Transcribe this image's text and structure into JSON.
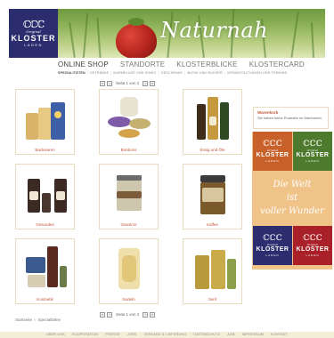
{
  "brand": {
    "mark": "ℂℂℂ",
    "orig": "Original",
    "name": "KLOSTER",
    "sub": "LADEN"
  },
  "hero": {
    "text": "Naturnah"
  },
  "main_nav": [
    "ONLINE SHOP",
    "STANDORTE",
    "KLOSTERBLICKE",
    "KLOSTERCARD"
  ],
  "sub_nav": [
    "SPEZIALITÄTEN",
    "GETRÄNKE",
    "MARMELADE UND HONIG",
    "GESCHENKE",
    "MUSIK UND BÜCHER",
    "VERANSTALTUNGEN UND TERMINE"
  ],
  "pager": {
    "prev": "‹",
    "next": "›",
    "first": "«",
    "last": "»",
    "text": "Seite 1 von 2"
  },
  "products": [
    {
      "label": "Backwaren"
    },
    {
      "label": "Bonbons"
    },
    {
      "label": "Essig und Öle"
    },
    {
      "label": "Gesundes"
    },
    {
      "label": "Gewürze"
    },
    {
      "label": "Kaffee"
    },
    {
      "label": "Kosmetik"
    },
    {
      "label": "Nudeln"
    },
    {
      "label": "Senf"
    }
  ],
  "cart": {
    "title": "Warenkorb",
    "text": "Sie haben keine Produkte im Warenkorb."
  },
  "promo": {
    "line1": "Die Welt",
    "line2": "ist",
    "line3": "voller Wunder"
  },
  "breadcrumb": [
    "Startseite",
    "Spezialitäten"
  ],
  "breadcrumb_sep": "»",
  "footer": [
    "ÜBER UNS",
    "KOOPERATION",
    "PRESSE",
    "JOBS",
    "VERSAND & LIEFERUNG",
    "DATENSCHUTZ",
    "AGB",
    "IMPRESSUM",
    "KONTAKT"
  ],
  "colors": {
    "navy": "#2b2d6e",
    "orange": "#c8602a",
    "green": "#4e7a2e",
    "red": "#a92028",
    "promo_bg": "#f0c389",
    "accent_text": "#c0553a"
  }
}
